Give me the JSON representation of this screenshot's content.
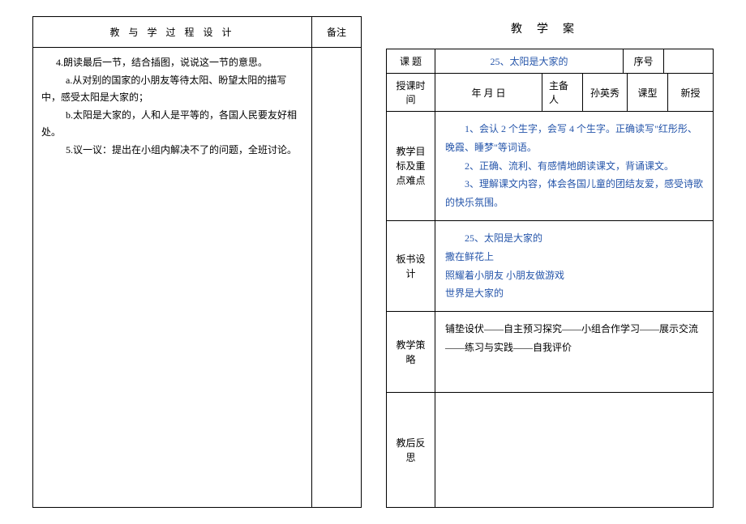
{
  "left": {
    "header_main": "教 与 学 过 程 设 计",
    "header_note": "备注",
    "p1": "4.朗读最后一节，结合插图，说说这一节的意思。",
    "p2": "a.从对别的国家的小朋友等待太阳、盼望太阳的描写中，感受太阳是大家的；",
    "p3": "b.太阳是大家的，人和人是平等的，各国人民要友好相处。",
    "p4": "5.议一议：提出在小组内解决不了的问题，全班讨论。"
  },
  "right": {
    "page_title": "教学案",
    "row_topic": {
      "label": "课    题",
      "value": "25、太阳是大家的",
      "seq_label": "序号",
      "seq_value": ""
    },
    "row_teach": {
      "label": "授课时间",
      "date": "年    月    日",
      "prep_label": "主备人",
      "prep_value": "孙英秀",
      "type_label": "课型",
      "type_value": "新授"
    },
    "targets": {
      "label": "教学目标及重点难点",
      "line1": "1、会认 2 个生字，会写 4 个生字。正确读写\"红彤彤、晚霞、睡梦\"等词语。",
      "line2": "2、正确、流利、有感情地朗读课文，背诵课文。",
      "line3": "3、理解课文内容，体会各国儿童的团结友爱，感受诗歌的快乐氛围。"
    },
    "board": {
      "label": "板书设计",
      "line1": "25、太阳是大家的",
      "line2": "撒在鲜花上",
      "line3": "照耀着小朋友    小朋友做游戏",
      "line4": "世界是大家的"
    },
    "strategy": {
      "label": "教学策略",
      "text": "铺垫设伏——自主预习探究——小组合作学习——展示交流——练习与实践——自我评价"
    },
    "reflect": {
      "label": "教后反思",
      "text": ""
    }
  }
}
